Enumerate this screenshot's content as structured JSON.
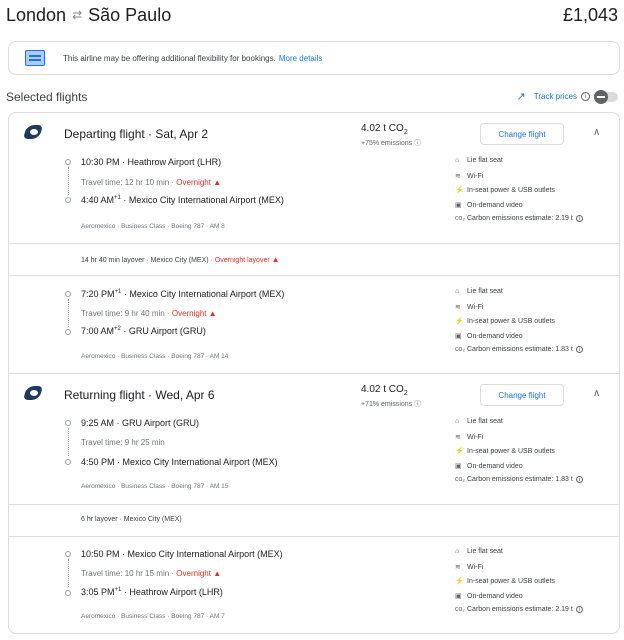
{
  "header": {
    "origin": "London",
    "swap_icon": "swap-arrows-icon",
    "destination": "São Paulo",
    "price": "£1,043"
  },
  "banner": {
    "text": "This airline may be offering additional flexibility for bookings.",
    "link": "More details"
  },
  "selected_title": "Selected flights",
  "track": {
    "label": "Track prices"
  },
  "departing": {
    "title": "Departing flight · Sat, Apr 2",
    "co2": "4.02 t CO",
    "co2_sub": "2",
    "emissions": "+75% emissions",
    "change_label": "Change flight",
    "segments": [
      {
        "dep_time": "10:30 PM",
        "dep_sup": "",
        "dep_airport": "Heathrow Airport (LHR)",
        "travel": "Travel time: 12 hr 10 min",
        "overnight": "Overnight",
        "arr_time": "4:40 AM",
        "arr_sup": "+1",
        "arr_airport": "Mexico City International Airport (MEX)",
        "meta": "Aeromexico · Business Class · Boeing 787 · AM 8",
        "amenities": [
          "Lie flat seat",
          "Wi-Fi",
          "In-seat power & USB outlets",
          "On-demand video",
          "Carbon emissions estimate: 2.19 t"
        ]
      },
      {
        "dep_time": "7:20 PM",
        "dep_sup": "+1",
        "dep_airport": "Mexico City International Airport (MEX)",
        "travel": "Travel time: 9 hr 40 min",
        "overnight": "Overnight",
        "arr_time": "7:00 AM",
        "arr_sup": "+2",
        "arr_airport": "GRU Airport (GRU)",
        "meta": "Aeromexico · Business Class · Boeing 787 · AM 14",
        "amenities": [
          "Lie flat seat",
          "Wi-Fi",
          "In-seat power & USB outlets",
          "On-demand video",
          "Carbon emissions estimate: 1.83 t"
        ]
      }
    ],
    "layover": {
      "text": "14 hr 40 min layover · Mexico City (MEX) · ",
      "overnight": "Overnight layover"
    }
  },
  "returning": {
    "title": "Returning flight · Wed, Apr 6",
    "co2": "4.02 t CO",
    "co2_sub": "2",
    "emissions": "+71% emissions",
    "change_label": "Change flight",
    "segments": [
      {
        "dep_time": "9:25 AM",
        "dep_sup": "",
        "dep_airport": "GRU Airport (GRU)",
        "travel": "Travel time: 9 hr 25 min",
        "overnight": "",
        "arr_time": "4:50 PM",
        "arr_sup": "",
        "arr_airport": "Mexico City International Airport (MEX)",
        "meta": "Aeromexico · Business Class · Boeing 787 · AM 15",
        "amenities": [
          "Lie flat seat",
          "Wi-Fi",
          "In-seat power & USB outlets",
          "On-demand video",
          "Carbon emissions estimate: 1.83 t"
        ]
      },
      {
        "dep_time": "10:50 PM",
        "dep_sup": "",
        "dep_airport": "Mexico City International Airport (MEX)",
        "travel": "Travel time: 10 hr 15 min",
        "overnight": "Overnight",
        "arr_time": "3:05 PM",
        "arr_sup": "+1",
        "arr_airport": "Heathrow Airport (LHR)",
        "meta": "Aeromexico · Business Class · Boeing 787 · AM 7",
        "amenities": [
          "Lie flat seat",
          "Wi-Fi",
          "In-seat power & USB outlets",
          "On-demand video",
          "Carbon emissions estimate: 2.19 t"
        ]
      }
    ],
    "layover": {
      "text": "6 hr layover · Mexico City (MEX)",
      "overnight": ""
    }
  },
  "colors": {
    "accent": "#1a73e8",
    "warning": "#d93025",
    "border": "#dadce0"
  }
}
